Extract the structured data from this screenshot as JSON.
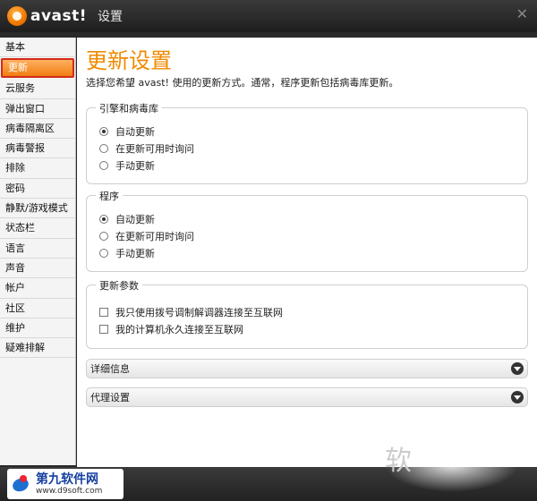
{
  "titlebar": {
    "logo_text": "avast!",
    "title": "设置",
    "close_glyph": "✕"
  },
  "sidebar": {
    "items": [
      {
        "label": "基本"
      },
      {
        "label": "更新",
        "active": true
      },
      {
        "label": "云服务"
      },
      {
        "label": "弹出窗口"
      },
      {
        "label": "病毒隔离区"
      },
      {
        "label": "病毒警报"
      },
      {
        "label": "排除"
      },
      {
        "label": "密码"
      },
      {
        "label": "静默/游戏模式"
      },
      {
        "label": "状态栏"
      },
      {
        "label": "语言"
      },
      {
        "label": "声音"
      },
      {
        "label": "帐户"
      },
      {
        "label": "社区"
      },
      {
        "label": "维护"
      },
      {
        "label": "疑难排解"
      }
    ]
  },
  "main": {
    "title": "更新设置",
    "description": "选择您希望 avast! 使用的更新方式。通常，程序更新包括病毒库更新。",
    "engine_group": {
      "title": "引擎和病毒库",
      "options": [
        "自动更新",
        "在更新可用时询问",
        "手动更新"
      ],
      "selected": 0
    },
    "program_group": {
      "title": "程序",
      "options": [
        "自动更新",
        "在更新可用时询问",
        "手动更新"
      ],
      "selected": 0
    },
    "params_group": {
      "title": "更新参数",
      "options": [
        "我只使用拨号调制解调器连接至互联网",
        "我的计算机永久连接至互联网"
      ]
    },
    "details_label": "详细信息",
    "proxy_label": "代理设置"
  },
  "watermark": {
    "name": "第九软件网",
    "url": "www.d9soft.com",
    "right_glyph": "软"
  },
  "colors": {
    "accent": "#f08a00",
    "active_border": "#d42a1a"
  }
}
